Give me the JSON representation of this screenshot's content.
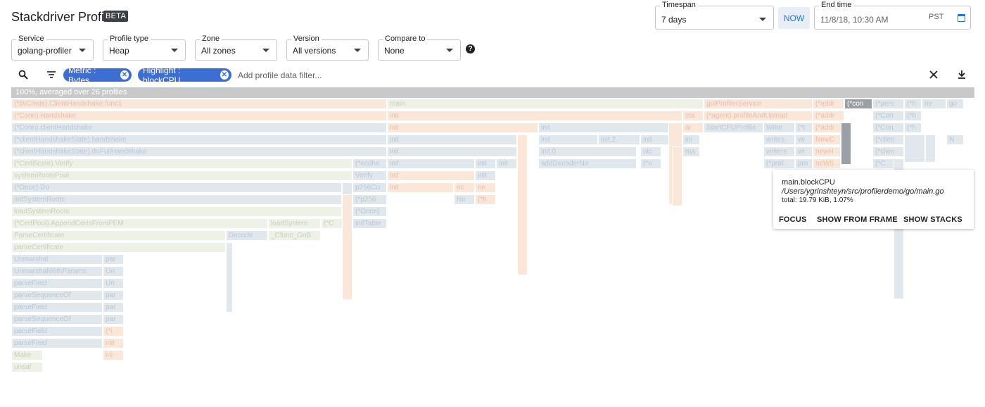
{
  "app": {
    "title": "Stackdriver Profiler",
    "badge": "BETA"
  },
  "controls": {
    "timespan": {
      "label": "Timespan",
      "value": "7 days"
    },
    "now_button": "NOW",
    "end_time": {
      "label": "End time",
      "value": "11/8/18, 10:30 AM",
      "tz": "PST"
    },
    "service": {
      "label": "Service",
      "value": "golang-profiler"
    },
    "profile_type": {
      "label": "Profile type",
      "value": "Heap"
    },
    "zone": {
      "label": "Zone",
      "value": "All zones"
    },
    "version": {
      "label": "Version",
      "value": "All versions"
    },
    "compare_to": {
      "label": "Compare to",
      "value": "None"
    }
  },
  "filters": {
    "chips": [
      "Metric : Bytes",
      "Highlight : blockCPU"
    ],
    "placeholder": "Add profile data filter..."
  },
  "flamegraph": {
    "header": "100%, averaged over 26 profiles",
    "frames": [
      {
        "t": "(*tlsCreds).ClientHandshake.func1",
        "c": "o"
      },
      {
        "t": "main",
        "c": "g"
      },
      {
        "t": "golProfilerService",
        "c": "o"
      },
      {
        "t": "(*addr",
        "c": "o"
      },
      {
        "t": "(*con",
        "c": "d"
      },
      {
        "t": "(*pers",
        "c": "b"
      },
      {
        "t": "(*h",
        "c": "b"
      },
      {
        "t": "ne",
        "c": "b"
      },
      {
        "t": "go",
        "c": "b"
      },
      {
        "t": "(*Conn).Handshake",
        "c": "o"
      },
      {
        "t": "init",
        "c": "o"
      },
      {
        "t": "sta",
        "c": "o"
      },
      {
        "t": "(*agent).profileAndUpload",
        "c": "o"
      },
      {
        "t": "(*addr",
        "c": "o"
      },
      {
        "t": "(*Con",
        "c": "b"
      },
      {
        "t": "(*h",
        "c": "b"
      },
      {
        "t": "(*Conn).clientHandshake",
        "c": "b"
      },
      {
        "t": "init",
        "c": "o"
      },
      {
        "t": "init",
        "c": "b"
      },
      {
        "t": "ar",
        "c": "o"
      },
      {
        "t": "StartCPUProfile",
        "c": "b"
      },
      {
        "t": "Write",
        "c": "b"
      },
      {
        "t": "(*t",
        "c": "b"
      },
      {
        "t": "(*addr",
        "c": "o"
      },
      {
        "t": "(*Con",
        "c": "b"
      },
      {
        "t": "(*h",
        "c": "b"
      },
      {
        "t": "(*clientHandshakeState).handshake",
        "c": "b"
      },
      {
        "t": "init",
        "c": "b"
      },
      {
        "t": "init",
        "c": "b"
      },
      {
        "t": "init.2",
        "c": "b"
      },
      {
        "t": "init",
        "c": "b"
      },
      {
        "t": "ini",
        "c": "b"
      },
      {
        "t": "writes",
        "c": "b"
      },
      {
        "t": "wr",
        "c": "b"
      },
      {
        "t": "NewC",
        "c": "o"
      },
      {
        "t": "(*clien",
        "c": "b"
      },
      {
        "t": "N",
        "c": "b"
      },
      {
        "t": "(*clientHandshakeState).doFullHandshake",
        "c": "b"
      },
      {
        "t": "init",
        "c": "b"
      },
      {
        "t": "init.0",
        "c": "b"
      },
      {
        "t": "nic",
        "c": "b"
      },
      {
        "t": "ma",
        "c": "b"
      },
      {
        "t": "writers",
        "c": "b"
      },
      {
        "t": "wr",
        "c": "b"
      },
      {
        "t": "newH",
        "c": "o"
      },
      {
        "t": "(*clien",
        "c": "b"
      },
      {
        "t": "(*Certificate).Verify",
        "c": "g"
      },
      {
        "t": "(*ecdhe",
        "c": "b"
      },
      {
        "t": "init",
        "c": "b"
      },
      {
        "t": "init",
        "c": "b"
      },
      {
        "t": "init",
        "c": "b"
      },
      {
        "t": "addDecoderNo",
        "c": "b"
      },
      {
        "t": "(*n",
        "c": "b"
      },
      {
        "t": "(*prof",
        "c": "b"
      },
      {
        "t": "pro",
        "c": "b"
      },
      {
        "t": "neW5",
        "c": "o"
      },
      {
        "t": "(*C",
        "c": "b"
      },
      {
        "t": "systemRootsPool",
        "c": "g"
      },
      {
        "t": "Verify",
        "c": "b"
      },
      {
        "t": "init",
        "c": "o"
      },
      {
        "t": "init",
        "c": "b"
      },
      {
        "t": "(*Once).Do",
        "c": "b"
      },
      {
        "t": "p256Cu",
        "c": "b"
      },
      {
        "t": "init",
        "c": "o"
      },
      {
        "t": "nc",
        "c": "o"
      },
      {
        "t": "ne",
        "c": "o"
      },
      {
        "t": "initSystemRoots",
        "c": "b"
      },
      {
        "t": "(*p256",
        "c": "b"
      },
      {
        "t": "Ne",
        "c": "b"
      },
      {
        "t": "(*h",
        "c": "o"
      },
      {
        "t": "loadSystemRoots",
        "c": "g"
      },
      {
        "t": "(*Once)",
        "c": "b"
      },
      {
        "t": "(*CertPool).AppendCertsFromPEM",
        "c": "g"
      },
      {
        "t": "loadSystem",
        "c": "g"
      },
      {
        "t": "(*C",
        "c": "g"
      },
      {
        "t": "initTable",
        "c": "b"
      },
      {
        "t": "ParseCertificate",
        "c": "g"
      },
      {
        "t": "Decode",
        "c": "b"
      },
      {
        "t": "_Cfunc_GoB",
        "c": "g"
      },
      {
        "t": "parseCertificate",
        "c": "g"
      },
      {
        "t": "Unmarshal",
        "c": "b"
      },
      {
        "t": "par",
        "c": "b"
      },
      {
        "t": "UnmarshalWithParams",
        "c": "b"
      },
      {
        "t": "Un",
        "c": "b"
      },
      {
        "t": "parseField",
        "c": "b"
      },
      {
        "t": "Un",
        "c": "b"
      },
      {
        "t": "parseSequenceOf",
        "c": "b"
      },
      {
        "t": "par",
        "c": "b"
      },
      {
        "t": "parseField",
        "c": "b"
      },
      {
        "t": "par",
        "c": "b"
      },
      {
        "t": "parseSequenceOf",
        "c": "b"
      },
      {
        "t": "par",
        "c": "b"
      },
      {
        "t": "parseField",
        "c": "b"
      },
      {
        "t": "(*i",
        "c": "o"
      },
      {
        "t": "parseField",
        "c": "b"
      },
      {
        "t": "init",
        "c": "o"
      },
      {
        "t": "Make",
        "c": "g"
      },
      {
        "t": "ini",
        "c": "o"
      },
      {
        "t": "unsaf",
        "c": "g"
      }
    ]
  },
  "tooltip": {
    "function": "main.blockCPU",
    "path": "/Users/ygrinshteyn/src/profilerdemo/go/main.go",
    "total": "total: 19.79 KiB, 1.07%",
    "actions": [
      "FOCUS",
      "SHOW FROM FRAME",
      "SHOW STACKS"
    ]
  }
}
